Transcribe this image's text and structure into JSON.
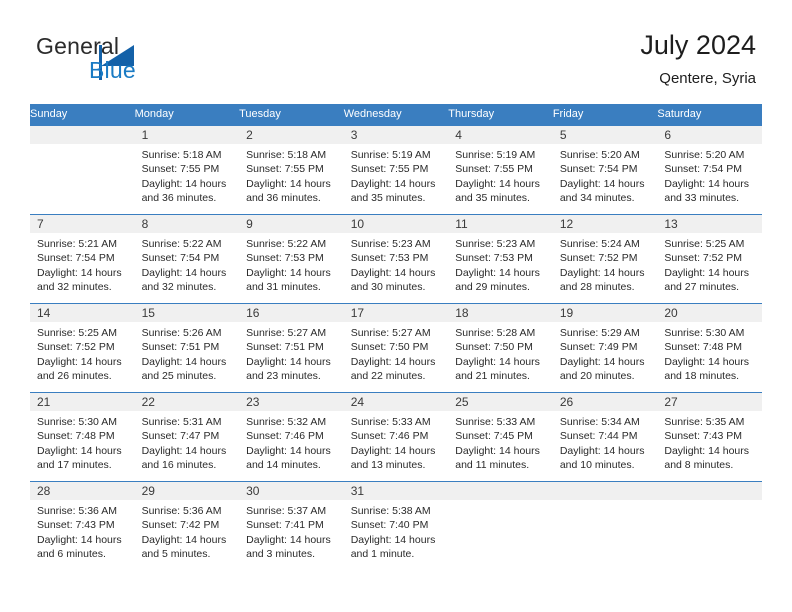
{
  "brand": {
    "name_part1": "General",
    "name_part2": "Blue",
    "accent_color": "#1461a8",
    "blue_text_color": "#1a7bc4"
  },
  "header": {
    "title": "July 2024",
    "subtitle": "Qentere, Syria"
  },
  "calendar": {
    "header_bg": "#3a7ec0",
    "daynum_bg": "#f0f0f0",
    "weekday_headers": [
      "Sunday",
      "Monday",
      "Tuesday",
      "Wednesday",
      "Thursday",
      "Friday",
      "Saturday"
    ],
    "weeks": [
      [
        {
          "day": "",
          "lines": []
        },
        {
          "day": "1",
          "lines": [
            "Sunrise: 5:18 AM",
            "Sunset: 7:55 PM",
            "Daylight: 14 hours",
            "and 36 minutes."
          ]
        },
        {
          "day": "2",
          "lines": [
            "Sunrise: 5:18 AM",
            "Sunset: 7:55 PM",
            "Daylight: 14 hours",
            "and 36 minutes."
          ]
        },
        {
          "day": "3",
          "lines": [
            "Sunrise: 5:19 AM",
            "Sunset: 7:55 PM",
            "Daylight: 14 hours",
            "and 35 minutes."
          ]
        },
        {
          "day": "4",
          "lines": [
            "Sunrise: 5:19 AM",
            "Sunset: 7:55 PM",
            "Daylight: 14 hours",
            "and 35 minutes."
          ]
        },
        {
          "day": "5",
          "lines": [
            "Sunrise: 5:20 AM",
            "Sunset: 7:54 PM",
            "Daylight: 14 hours",
            "and 34 minutes."
          ]
        },
        {
          "day": "6",
          "lines": [
            "Sunrise: 5:20 AM",
            "Sunset: 7:54 PM",
            "Daylight: 14 hours",
            "and 33 minutes."
          ]
        }
      ],
      [
        {
          "day": "7",
          "lines": [
            "Sunrise: 5:21 AM",
            "Sunset: 7:54 PM",
            "Daylight: 14 hours",
            "and 32 minutes."
          ]
        },
        {
          "day": "8",
          "lines": [
            "Sunrise: 5:22 AM",
            "Sunset: 7:54 PM",
            "Daylight: 14 hours",
            "and 32 minutes."
          ]
        },
        {
          "day": "9",
          "lines": [
            "Sunrise: 5:22 AM",
            "Sunset: 7:53 PM",
            "Daylight: 14 hours",
            "and 31 minutes."
          ]
        },
        {
          "day": "10",
          "lines": [
            "Sunrise: 5:23 AM",
            "Sunset: 7:53 PM",
            "Daylight: 14 hours",
            "and 30 minutes."
          ]
        },
        {
          "day": "11",
          "lines": [
            "Sunrise: 5:23 AM",
            "Sunset: 7:53 PM",
            "Daylight: 14 hours",
            "and 29 minutes."
          ]
        },
        {
          "day": "12",
          "lines": [
            "Sunrise: 5:24 AM",
            "Sunset: 7:52 PM",
            "Daylight: 14 hours",
            "and 28 minutes."
          ]
        },
        {
          "day": "13",
          "lines": [
            "Sunrise: 5:25 AM",
            "Sunset: 7:52 PM",
            "Daylight: 14 hours",
            "and 27 minutes."
          ]
        }
      ],
      [
        {
          "day": "14",
          "lines": [
            "Sunrise: 5:25 AM",
            "Sunset: 7:52 PM",
            "Daylight: 14 hours",
            "and 26 minutes."
          ]
        },
        {
          "day": "15",
          "lines": [
            "Sunrise: 5:26 AM",
            "Sunset: 7:51 PM",
            "Daylight: 14 hours",
            "and 25 minutes."
          ]
        },
        {
          "day": "16",
          "lines": [
            "Sunrise: 5:27 AM",
            "Sunset: 7:51 PM",
            "Daylight: 14 hours",
            "and 23 minutes."
          ]
        },
        {
          "day": "17",
          "lines": [
            "Sunrise: 5:27 AM",
            "Sunset: 7:50 PM",
            "Daylight: 14 hours",
            "and 22 minutes."
          ]
        },
        {
          "day": "18",
          "lines": [
            "Sunrise: 5:28 AM",
            "Sunset: 7:50 PM",
            "Daylight: 14 hours",
            "and 21 minutes."
          ]
        },
        {
          "day": "19",
          "lines": [
            "Sunrise: 5:29 AM",
            "Sunset: 7:49 PM",
            "Daylight: 14 hours",
            "and 20 minutes."
          ]
        },
        {
          "day": "20",
          "lines": [
            "Sunrise: 5:30 AM",
            "Sunset: 7:48 PM",
            "Daylight: 14 hours",
            "and 18 minutes."
          ]
        }
      ],
      [
        {
          "day": "21",
          "lines": [
            "Sunrise: 5:30 AM",
            "Sunset: 7:48 PM",
            "Daylight: 14 hours",
            "and 17 minutes."
          ]
        },
        {
          "day": "22",
          "lines": [
            "Sunrise: 5:31 AM",
            "Sunset: 7:47 PM",
            "Daylight: 14 hours",
            "and 16 minutes."
          ]
        },
        {
          "day": "23",
          "lines": [
            "Sunrise: 5:32 AM",
            "Sunset: 7:46 PM",
            "Daylight: 14 hours",
            "and 14 minutes."
          ]
        },
        {
          "day": "24",
          "lines": [
            "Sunrise: 5:33 AM",
            "Sunset: 7:46 PM",
            "Daylight: 14 hours",
            "and 13 minutes."
          ]
        },
        {
          "day": "25",
          "lines": [
            "Sunrise: 5:33 AM",
            "Sunset: 7:45 PM",
            "Daylight: 14 hours",
            "and 11 minutes."
          ]
        },
        {
          "day": "26",
          "lines": [
            "Sunrise: 5:34 AM",
            "Sunset: 7:44 PM",
            "Daylight: 14 hours",
            "and 10 minutes."
          ]
        },
        {
          "day": "27",
          "lines": [
            "Sunrise: 5:35 AM",
            "Sunset: 7:43 PM",
            "Daylight: 14 hours",
            "and 8 minutes."
          ]
        }
      ],
      [
        {
          "day": "28",
          "lines": [
            "Sunrise: 5:36 AM",
            "Sunset: 7:43 PM",
            "Daylight: 14 hours",
            "and 6 minutes."
          ]
        },
        {
          "day": "29",
          "lines": [
            "Sunrise: 5:36 AM",
            "Sunset: 7:42 PM",
            "Daylight: 14 hours",
            "and 5 minutes."
          ]
        },
        {
          "day": "30",
          "lines": [
            "Sunrise: 5:37 AM",
            "Sunset: 7:41 PM",
            "Daylight: 14 hours",
            "and 3 minutes."
          ]
        },
        {
          "day": "31",
          "lines": [
            "Sunrise: 5:38 AM",
            "Sunset: 7:40 PM",
            "Daylight: 14 hours",
            "and 1 minute."
          ]
        },
        {
          "day": "",
          "lines": []
        },
        {
          "day": "",
          "lines": []
        },
        {
          "day": "",
          "lines": []
        }
      ]
    ]
  }
}
